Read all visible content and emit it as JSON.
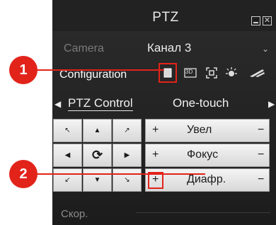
{
  "window": {
    "title": "PTZ",
    "minimize_icon": "minimize-icon",
    "close_icon": "close-icon",
    "close_glyph": "✕"
  },
  "camera": {
    "label": "Camera",
    "value": "Канал 3"
  },
  "configuration": {
    "label": "Configuration",
    "icons": [
      "preset-icon",
      "3d-icon",
      "focus-frame-icon",
      "light-icon",
      "wiper-icon"
    ],
    "icon_3d_text": "3D"
  },
  "tabs": [
    "PTZ Control",
    "One-touch"
  ],
  "direction_pad": {
    "arrows": [
      "↖",
      "▲",
      "↗",
      "◀",
      "⟳",
      "▶",
      "↙",
      "▼",
      "↘"
    ]
  },
  "controls": [
    {
      "plus": "+",
      "label": "Увел",
      "minus": "−"
    },
    {
      "plus": "+",
      "label": "Фокус",
      "minus": "−"
    },
    {
      "plus": "+",
      "label": "Диафр.",
      "minus": "−"
    }
  ],
  "speed": {
    "label": "Скор."
  },
  "callouts": [
    "1",
    "2"
  ],
  "colors": {
    "callout_red": "#e2231a",
    "panel_bg": "#2c2c2c"
  }
}
